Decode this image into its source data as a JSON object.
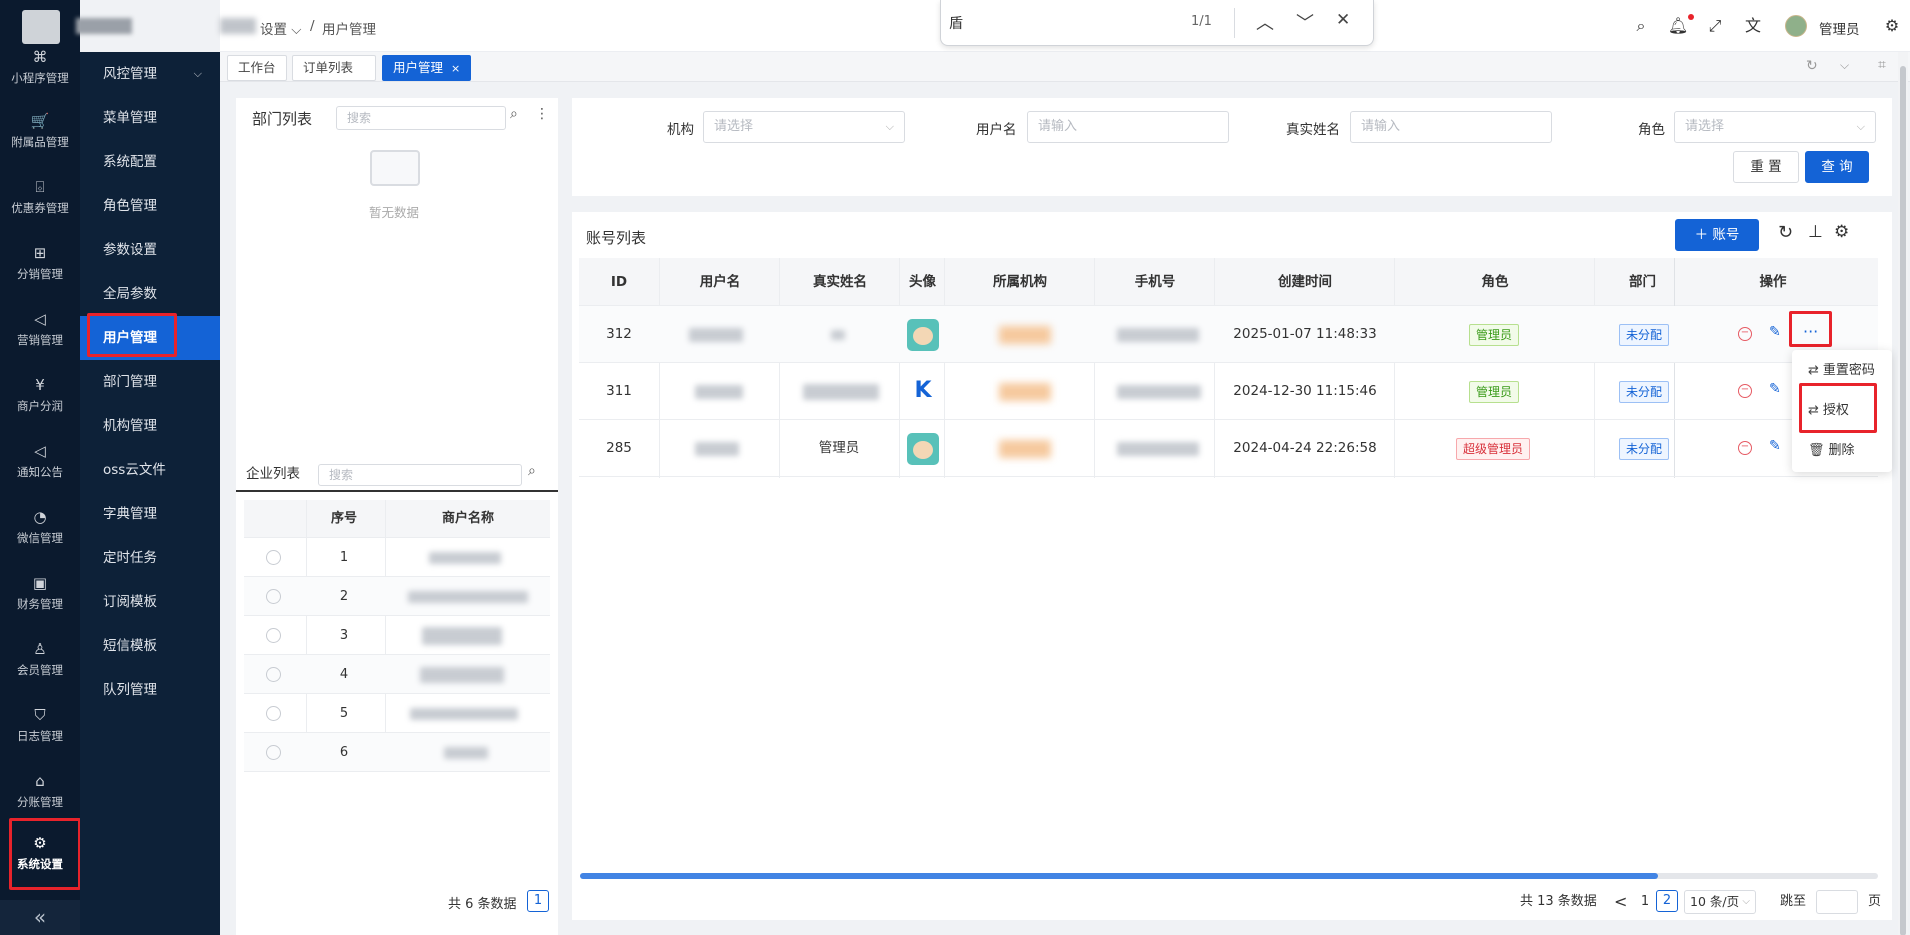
{
  "rail": {
    "items": [
      {
        "label": "小程序管理",
        "icon": "mini-program-icon"
      },
      {
        "label": "附属品管理",
        "icon": "cart-icon"
      },
      {
        "label": "优惠券管理",
        "icon": "gift-icon"
      },
      {
        "label": "分销管理",
        "icon": "distribution-icon"
      },
      {
        "label": "营销管理",
        "icon": "megaphone-icon"
      },
      {
        "label": "商户分润",
        "icon": "yen-icon"
      },
      {
        "label": "通知公告",
        "icon": "notice-icon"
      },
      {
        "label": "微信管理",
        "icon": "wechat-icon"
      },
      {
        "label": "财务管理",
        "icon": "finance-icon"
      },
      {
        "label": "会员管理",
        "icon": "member-icon"
      },
      {
        "label": "日志管理",
        "icon": "shield-icon"
      },
      {
        "label": "分账管理",
        "icon": "split-icon"
      },
      {
        "label": "系统设置",
        "icon": "gear-icon"
      }
    ],
    "collapse_glyph": "«"
  },
  "submenu": {
    "items": [
      {
        "label": "风控管理"
      },
      {
        "label": "菜单管理"
      },
      {
        "label": "系统配置"
      },
      {
        "label": "角色管理"
      },
      {
        "label": "参数设置"
      },
      {
        "label": "全局参数"
      },
      {
        "label": "用户管理"
      },
      {
        "label": "部门管理"
      },
      {
        "label": "机构管理"
      },
      {
        "label": "oss云文件"
      },
      {
        "label": "字典管理"
      },
      {
        "label": "定时任务"
      },
      {
        "label": "订阅模板"
      },
      {
        "label": "短信模板"
      },
      {
        "label": "队列管理"
      }
    ],
    "caret": "⌵"
  },
  "header": {
    "crumb_parent": "设置",
    "crumb_sep": "/",
    "crumb_current": "用户管理",
    "user_name": "管理员"
  },
  "findbar": {
    "query": "盾",
    "count": "1/1",
    "prev": "︿",
    "next": "﹀",
    "close": "✕"
  },
  "tabs": [
    {
      "label": "工作台"
    },
    {
      "label": "订单列表"
    },
    {
      "label": "用户管理",
      "close": "×"
    }
  ],
  "dept": {
    "title": "部门列表",
    "search_placeholder": "搜索",
    "empty_text": "暂无数据"
  },
  "company": {
    "title": "企业列表",
    "search_placeholder": "搜索",
    "headers": [
      "序号",
      "商户名称"
    ],
    "rows": [
      {
        "no": "1"
      },
      {
        "no": "2"
      },
      {
        "no": "3"
      },
      {
        "no": "4"
      },
      {
        "no": "5"
      },
      {
        "no": "6"
      }
    ],
    "total_text": "共 6 条数据",
    "page": "1"
  },
  "filters": {
    "org_label": "机构",
    "org_placeholder": "请选择",
    "username_label": "用户名",
    "username_placeholder": "请输入",
    "realname_label": "真实姓名",
    "realname_placeholder": "请输入",
    "role_label": "角色",
    "role_placeholder": "请选择",
    "reset": "重 置",
    "query": "查 询"
  },
  "accounts": {
    "title": "账号列表",
    "add_button": "＋ 账号",
    "headers": [
      "ID",
      "用户名",
      "真实姓名",
      "头像",
      "所属机构",
      "手机号",
      "创建时间",
      "角色",
      "部门",
      "操作"
    ],
    "rows": [
      {
        "id": "312",
        "realname": "",
        "created": "2025-01-07 11:48:33",
        "role": "管理员",
        "role_type": "green",
        "dept": "未分配"
      },
      {
        "id": "311",
        "realname": "",
        "created": "2024-12-30 11:15:46",
        "role": "管理员",
        "role_type": "green",
        "dept": "未分配"
      },
      {
        "id": "285",
        "realname": "管理员",
        "created": "2024-04-24 22:26:58",
        "role": "超级管理员",
        "role_type": "red",
        "dept": "未分配"
      }
    ],
    "more_glyph": "···",
    "total_text": "共 13 条数据",
    "page_prev": "<",
    "page_1": "1",
    "page_2": "2",
    "page_size": "10 条/页",
    "jump_label": "跳至",
    "jump_suffix": "页"
  },
  "dropdown": {
    "items": [
      {
        "label": "重置密码"
      },
      {
        "label": "授权"
      },
      {
        "label": "删除"
      }
    ]
  },
  "colors": {
    "primary": "#1463d6",
    "sidebar": "#0b1a2e",
    "highlight": "#e8232b"
  }
}
